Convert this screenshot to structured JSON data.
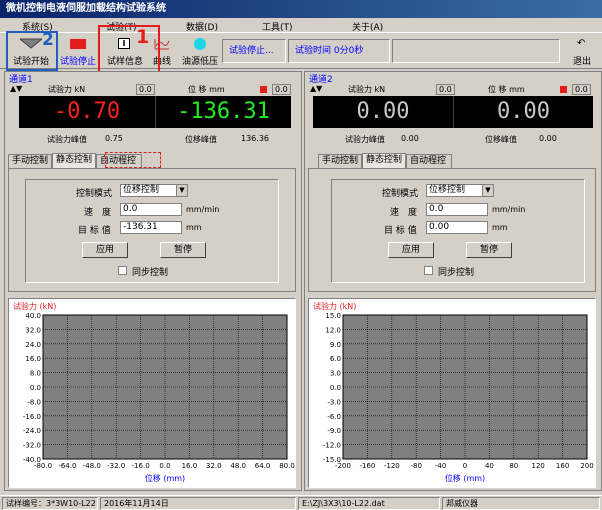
{
  "window": {
    "title": "微机控制电液伺服加载结构试验系统"
  },
  "menu": [
    "系统(S)",
    "试验(T)",
    "数据(D)",
    "工具(T)",
    "关于(A)"
  ],
  "toolbar": {
    "start_label": "试验开始",
    "stop_label": "试验停止",
    "info_label": "试样信息",
    "curve_label": "曲线",
    "pump_label": "油源低压",
    "exit_label": "退出",
    "status_text": "试验停止...",
    "time_text": "试验时间 0分0秒"
  },
  "annotations": {
    "num1": "1",
    "num2": "2"
  },
  "channels": [
    {
      "title": "通道1",
      "force_label": "试验力 kN",
      "force_small": "0.0",
      "disp_label": "位 移 mm",
      "disp_small": "0.0",
      "force_value": "-0.70",
      "disp_value": "-136.31",
      "force_color": "#ff2020",
      "disp_color": "#22ee22",
      "force_peak_label": "试验力峰值",
      "force_peak_value": "0.75",
      "disp_peak_label": "位移峰值",
      "disp_peak_value": "136.36",
      "tabs": [
        "手动控制",
        "静态控制",
        "自动程控"
      ],
      "active_tab": 1,
      "mode_label": "控制模式",
      "mode_value": "位移控制",
      "speed_label": "速　度",
      "speed_value": "0.0",
      "speed_unit": "mm/min",
      "target_label": "目 标 值",
      "target_value": "-136.31",
      "target_unit": "mm",
      "apply_label": "应用",
      "pause_label": "暂停",
      "sync_label": "同步控制"
    },
    {
      "title": "通道2",
      "force_label": "试验力 kN",
      "force_small": "0.0",
      "disp_label": "位 移 mm",
      "disp_small": "0.0",
      "force_value": "0.00",
      "disp_value": "0.00",
      "force_color": "#c8c8c8",
      "disp_color": "#c8c8c8",
      "force_peak_label": "试验力峰值",
      "force_peak_value": "0.00",
      "disp_peak_label": "位移峰值",
      "disp_peak_value": "0.00",
      "tabs": [
        "手动控制",
        "静态控制",
        "自动程控"
      ],
      "active_tab": 1,
      "mode_label": "控制模式",
      "mode_value": "位移控制",
      "speed_label": "速　度",
      "speed_value": "0.0",
      "speed_unit": "mm/min",
      "target_label": "目 标 值",
      "target_value": "0.00",
      "target_unit": "mm",
      "apply_label": "应用",
      "pause_label": "暂停",
      "sync_label": "同步控制"
    }
  ],
  "chart_data": [
    {
      "type": "line",
      "ylabel": "试验力 (kN)",
      "xlabel": "位移 (mm)",
      "yticks": [
        "40.0",
        "32.0",
        "24.0",
        "16.0",
        "8.0",
        "0.0",
        "-8.0",
        "-16.0",
        "-24.0",
        "-32.0",
        "-40.0"
      ],
      "xticks": [
        "-80.0",
        "-64.0",
        "-48.0",
        "-32.0",
        "-16.0",
        "0.0",
        "16.0",
        "32.0",
        "48.0",
        "64.0",
        "80.0"
      ],
      "ylim": [
        -40,
        40
      ],
      "xlim": [
        -80,
        80
      ],
      "grid": true,
      "series": []
    },
    {
      "type": "line",
      "ylabel": "试验力 (kN)",
      "xlabel": "位移 (mm)",
      "yticks": [
        "15.0",
        "12.0",
        "9.0",
        "6.0",
        "3.0",
        "0.0",
        "-3.0",
        "-6.0",
        "-9.0",
        "-12.0",
        "-15.0"
      ],
      "xticks": [
        "-200",
        "-160",
        "-120",
        "-80",
        "-40",
        "0",
        "40",
        "80",
        "120",
        "160",
        "200"
      ],
      "ylim": [
        -15,
        15
      ],
      "xlim": [
        -200,
        200
      ],
      "grid": true,
      "series": []
    }
  ],
  "statusbar": {
    "sample_no": "试样编号：3*3W10-L22",
    "date": "2016年11月14日",
    "file": "E:\\ZJ\\3X3\\10-L22.dat",
    "vendor": "邦威仪器"
  }
}
